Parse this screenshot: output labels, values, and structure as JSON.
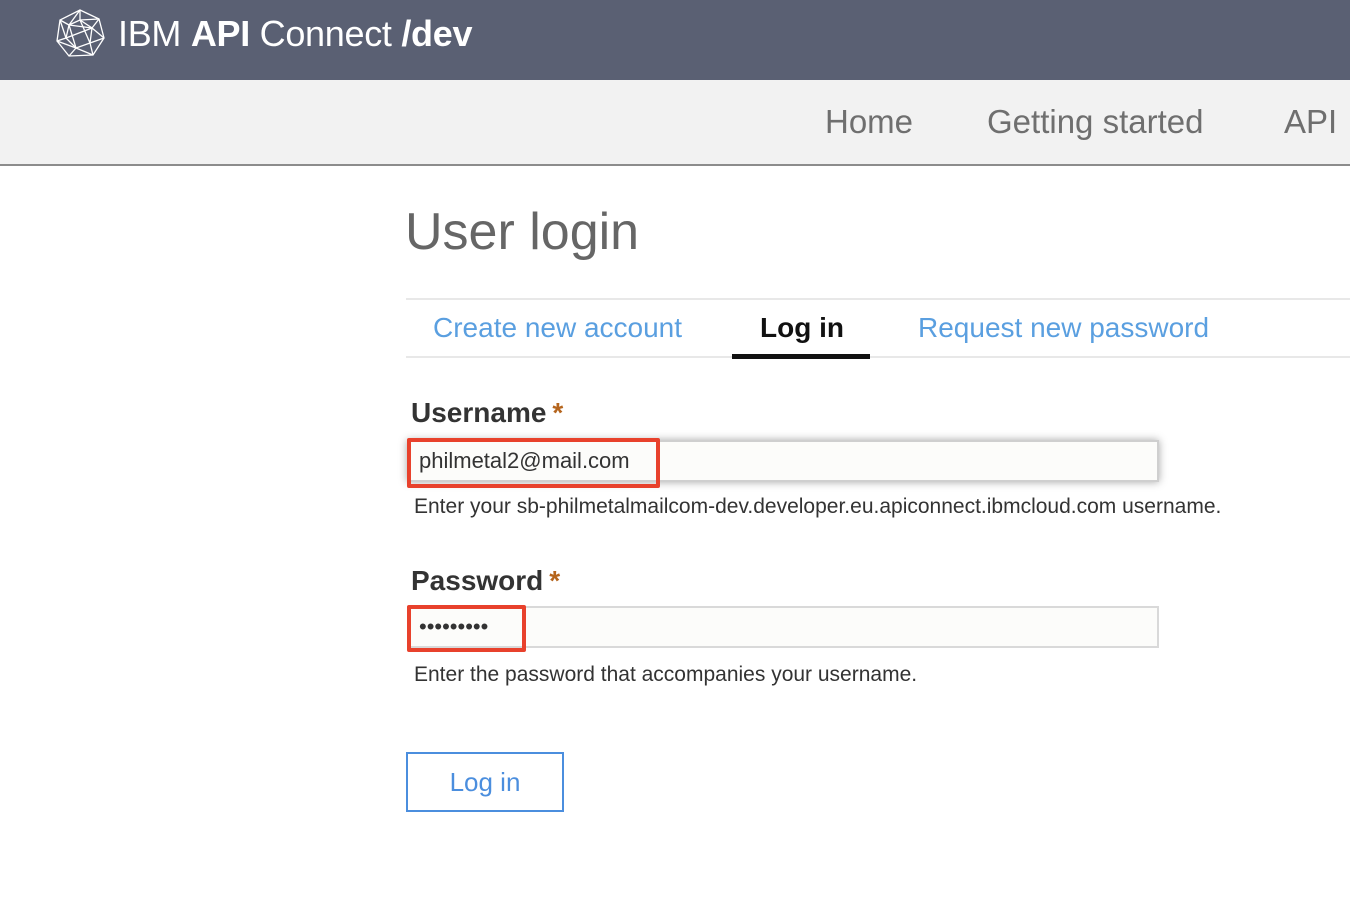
{
  "header": {
    "brand_prefix": "IBM",
    "brand_bold": "API",
    "brand_middle": "Connect",
    "brand_suffix": "/dev",
    "logo_icon": "ibm-api-connect-logo-icon"
  },
  "nav": {
    "items": [
      {
        "label": "Home"
      },
      {
        "label": "Getting started"
      },
      {
        "label": "API"
      }
    ]
  },
  "page": {
    "title": "User login"
  },
  "tabs": [
    {
      "label": "Create new account",
      "active": false
    },
    {
      "label": "Log in",
      "active": true
    },
    {
      "label": "Request new password",
      "active": false
    }
  ],
  "form": {
    "username": {
      "label": "Username",
      "required_mark": "*",
      "value": "philmetal2@mail.com",
      "help": "Enter your sb-philmetalmailcom-dev.developer.eu.apiconnect.ibmcloud.com username."
    },
    "password": {
      "label": "Password",
      "required_mark": "*",
      "value": "•••••••••",
      "help": "Enter the password that accompanies your username."
    },
    "submit_label": "Log in"
  },
  "colors": {
    "header_bg": "#5a6073",
    "nav_bg": "#f2f2f2",
    "link": "#5a9fe0",
    "highlight": "#e8412c",
    "required": "#b5651d",
    "button": "#4b8ede"
  }
}
